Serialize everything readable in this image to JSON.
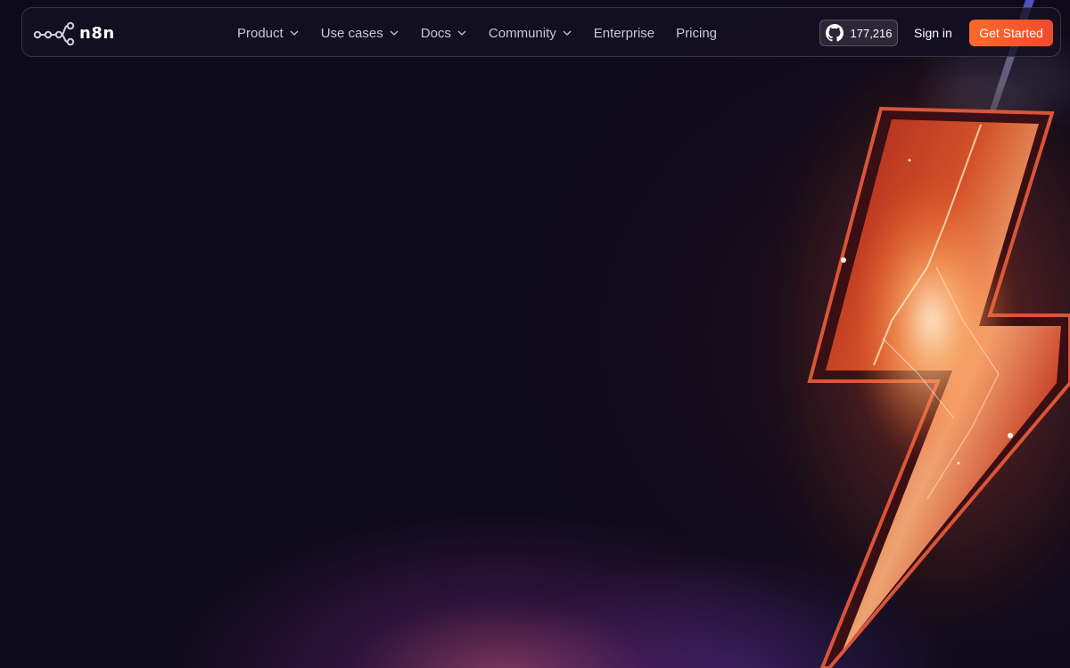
{
  "brand": {
    "name": "n8n",
    "accent_color": "#ee4b2b"
  },
  "nav": {
    "items": [
      {
        "label": "Product",
        "has_dropdown": true
      },
      {
        "label": "Use cases",
        "has_dropdown": true
      },
      {
        "label": "Docs",
        "has_dropdown": true
      },
      {
        "label": "Community",
        "has_dropdown": true
      },
      {
        "label": "Enterprise",
        "has_dropdown": false
      },
      {
        "label": "Pricing",
        "has_dropdown": false
      }
    ]
  },
  "github": {
    "stars": "177,216",
    "icon": "github-icon"
  },
  "auth": {
    "sign_in_label": "Sign in",
    "get_started_label": "Get Started"
  },
  "hero": {
    "art_icon": "lightning-bolt-icon"
  }
}
